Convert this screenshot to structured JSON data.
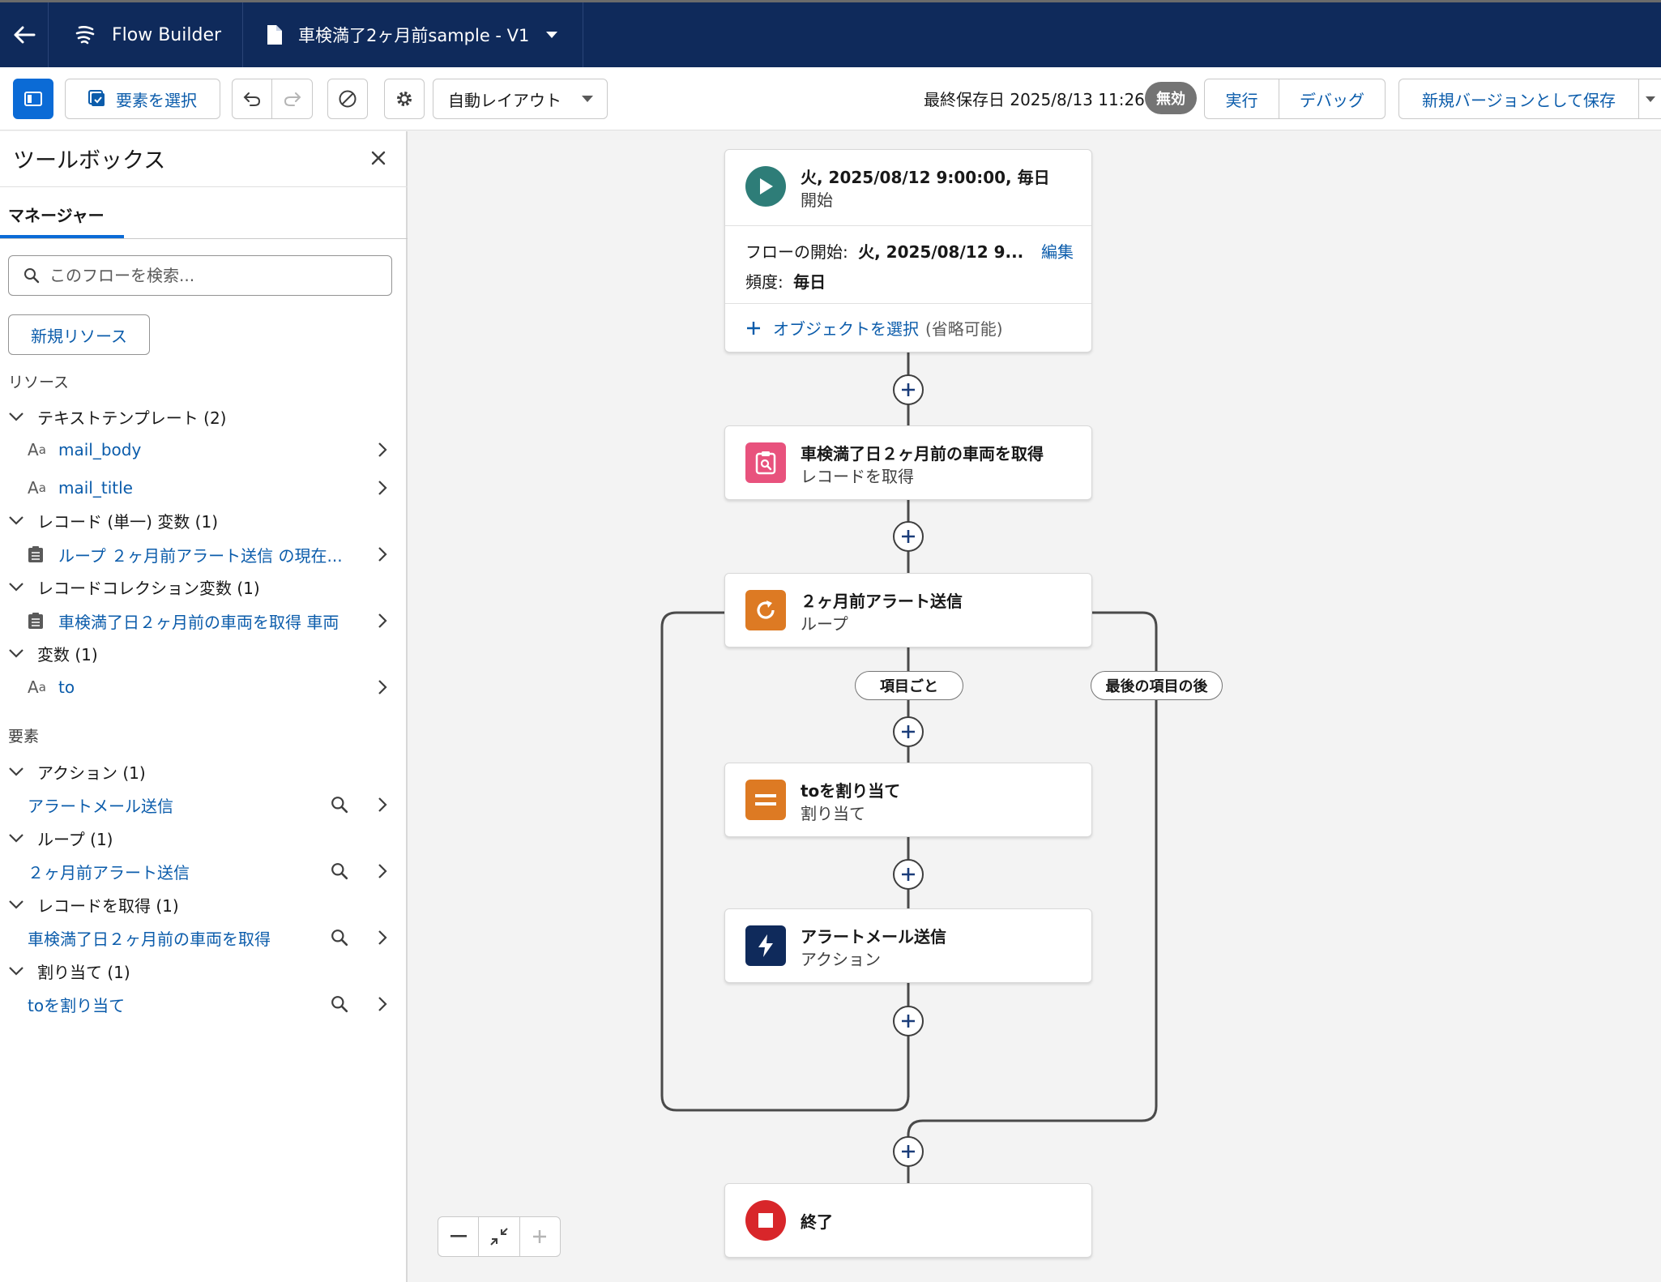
{
  "topbar": {
    "app_name": "Flow Builder",
    "flow_name": "車検満了2ヶ月前sample - V1"
  },
  "toolbar": {
    "select_elements": "要素を選択",
    "layout_select": "自動レイアウト",
    "last_saved": "最終保存日 2025/8/13 11:26",
    "status_badge": "無効",
    "run": "実行",
    "debug": "デバッグ",
    "save_new_version": "新規バージョンとして保存"
  },
  "sidebar": {
    "title": "ツールボックス",
    "tab": "マネージャー",
    "search_placeholder": "このフローを検索...",
    "new_resource": "新規リソース",
    "resources_heading": "リソース",
    "resources": [
      {
        "group": "テキストテンプレート (2)",
        "items": [
          "mail_body",
          "mail_title"
        ]
      },
      {
        "group": "レコード (単一) 変数 (1)",
        "items": [
          "ループ ２ヶ月前アラート送信 の現在..."
        ]
      },
      {
        "group": "レコードコレクション変数 (1)",
        "items": [
          "車検満了日２ヶ月前の車両を取得 車両"
        ]
      },
      {
        "group": "変数 (1)",
        "items": [
          "to"
        ]
      }
    ],
    "elements_heading": "要素",
    "elements": [
      {
        "group": "アクション (1)",
        "items": [
          "アラートメール送信"
        ]
      },
      {
        "group": "ループ (1)",
        "items": [
          "２ヶ月前アラート送信"
        ]
      },
      {
        "group": "レコードを取得 (1)",
        "items": [
          "車検満了日２ヶ月前の車両を取得"
        ]
      },
      {
        "group": "割り当て (1)",
        "items": [
          "toを割り当て"
        ]
      }
    ]
  },
  "flow": {
    "start": {
      "title": "火, 2025/08/12 9:00:00, 毎日",
      "subtitle": "開始",
      "flow_start_label": "フローの開始:",
      "flow_start_value": "火, 2025/08/12 9...",
      "edit": "編集",
      "frequency_label": "頻度:",
      "frequency_value": "毎日",
      "select_object": "オブジェクトを選択",
      "optional": "(省略可能)"
    },
    "get_records": {
      "title": "車検満了日２ヶ月前の車両を取得",
      "subtitle": "レコードを取得"
    },
    "loop": {
      "title": "２ヶ月前アラート送信",
      "subtitle": "ループ",
      "for_each": "項目ごと",
      "after_last": "最後の項目の後"
    },
    "assignment": {
      "title": "toを割り当て",
      "subtitle": "割り当て"
    },
    "action": {
      "title": "アラートメール送信",
      "subtitle": "アクション"
    },
    "end": {
      "title": "終了"
    }
  },
  "colors": {
    "header": "#0f2a5b",
    "brand_blue": "#0b6bd6",
    "link": "#0b5cab",
    "start_icon": "#2e7d78",
    "get_records_icon": "#e8527d",
    "loop_icon": "#dd7a23",
    "assignment_icon": "#dd7a23",
    "action_icon": "#0f2a5b",
    "end_icon": "#d8262a"
  }
}
